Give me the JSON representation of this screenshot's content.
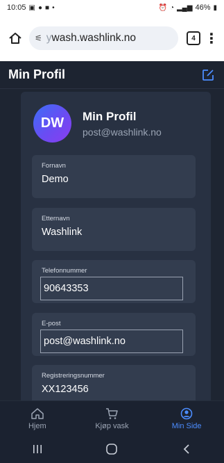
{
  "status_bar": {
    "time": "10:05",
    "battery": "46%"
  },
  "browser": {
    "url_prefix": "y",
    "url_text": "wash.washlink.no",
    "tab_count": "4"
  },
  "header": {
    "title": "Min Profil"
  },
  "profile": {
    "initials": "DW",
    "name": "Min Profil",
    "email": "post@washlink.no"
  },
  "fields": [
    {
      "label": "Fornavn",
      "value": "Demo"
    },
    {
      "label": "Etternavn",
      "value": "Washlink"
    },
    {
      "label": "Telefonnummer",
      "value": "90643353"
    },
    {
      "label": "E-post",
      "value": "post@washlink.no"
    },
    {
      "label": "Registreringsnummer",
      "value": "XX123456"
    }
  ],
  "bottom_nav": [
    {
      "label": "Hjem",
      "icon": "home-icon"
    },
    {
      "label": "Kjøp vask",
      "icon": "cart-icon"
    },
    {
      "label": "Min Side",
      "icon": "user-circle-icon",
      "active": true
    }
  ],
  "colors": {
    "accent": "#4c8dff",
    "background": "#1e2532",
    "card": "#283142"
  }
}
